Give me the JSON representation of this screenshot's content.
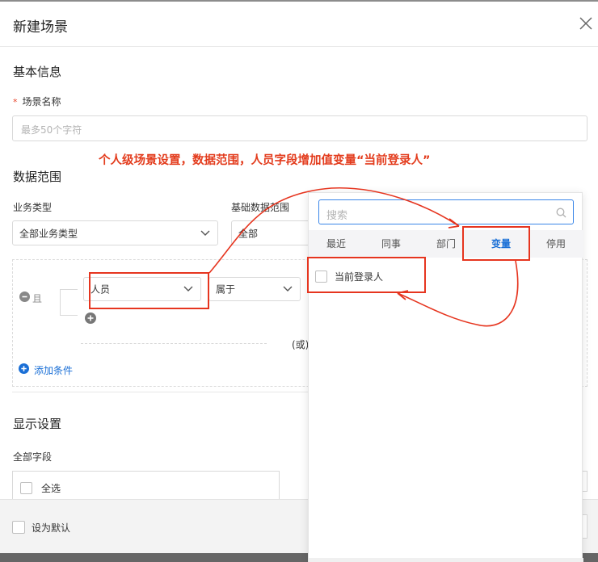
{
  "dialog": {
    "title": "新建场景",
    "close_icon": "close-icon"
  },
  "basic": {
    "heading": "基本信息",
    "name_label": "场景名称",
    "required_mark": "*",
    "name_placeholder": "最多50个字符"
  },
  "annotation": "个人级场景设置，数据范围，人员字段增加值变量“当前登录人”",
  "data_scope": {
    "heading": "数据范围",
    "biz_type_label": "业务类型",
    "biz_type_value": "全部业务类型",
    "base_scope_label": "基础数据范围",
    "base_scope_value": "全部"
  },
  "condition": {
    "and_label": "且",
    "field_value": "人员",
    "operator_value": "属于",
    "or_label": "(或)",
    "add_condition_label": "添加条件"
  },
  "display": {
    "heading": "显示设置",
    "all_fields_label": "全部字段",
    "select_all_label": "全选"
  },
  "footer": {
    "set_default_label": "设为默认"
  },
  "picker": {
    "search_placeholder": "搜索",
    "tabs": [
      "最近",
      "同事",
      "部门",
      "变量",
      "停用"
    ],
    "active_tab": "变量",
    "items": [
      {
        "label": "当前登录人"
      }
    ]
  },
  "colors": {
    "accent": "#1a6fd6",
    "annotation": "#e6351f",
    "footer_bg": "#f3f3f3"
  }
}
